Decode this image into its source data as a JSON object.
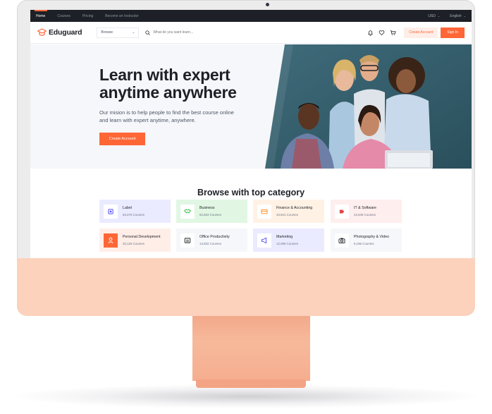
{
  "topbar": {
    "nav": [
      {
        "label": "Home",
        "active": true
      },
      {
        "label": "Courses",
        "active": false
      },
      {
        "label": "Pricing",
        "active": false
      },
      {
        "label": "Become an Instructor",
        "active": false
      }
    ],
    "currency": "USD",
    "language": "English"
  },
  "header": {
    "brand": "Eduguard",
    "browse_label": "Browse",
    "search_placeholder": "What do you want learn...",
    "icons": [
      "bell-icon",
      "heart-icon",
      "cart-icon"
    ],
    "create_account_label": "Create Account",
    "signin_label": "Sign In"
  },
  "hero": {
    "title_line1": "Learn with expert",
    "title_line2": "anytime anywhere",
    "description": "Our mision is to help people to find the best course online and learn with expert anytime, anywhere.",
    "cta_label": "Create Account"
  },
  "categories": {
    "title": "Browse with top category",
    "items": [
      {
        "name": "Label",
        "count": "63,476 Courses",
        "icon": "cpu-icon",
        "bg": "#ebebff",
        "icon_color": "#564ffd"
      },
      {
        "name": "Business",
        "count": "52,822 Courses",
        "icon": "handshake-icon",
        "bg": "#e1f7e3",
        "icon_color": "#23bd33"
      },
      {
        "name": "Finance & Accounting",
        "count": "33,841 Courses",
        "icon": "credit-card-icon",
        "bg": "#fff2e5",
        "icon_color": "#fd8e1f"
      },
      {
        "name": "IT & Software",
        "count": "22,649 Courses",
        "icon": "bug-icon",
        "bg": "#ffeeee",
        "icon_color": "#e34444"
      },
      {
        "name": "Personal Development",
        "count": "20,126 Courses",
        "icon": "user-icon",
        "bg": "#ffeee8",
        "icon_color": "#ffffff",
        "icon_bg": "#ff6636"
      },
      {
        "name": "Office Productivity",
        "count": "13,932 Courses",
        "icon": "receipt-icon",
        "bg": "#f5f7fa",
        "icon_color": "#1d2026"
      },
      {
        "name": "Marketing",
        "count": "12,068 Courses",
        "icon": "megaphone-icon",
        "bg": "#ebebff",
        "icon_color": "#564ffd"
      },
      {
        "name": "Photography & Video",
        "count": "6,196 Courses",
        "icon": "camera-icon",
        "bg": "#f5f7fa",
        "icon_color": "#1d2026"
      }
    ]
  },
  "colors": {
    "accent": "#ff6636",
    "dark": "#1d2026",
    "monitor_chin": "#fcd2bd",
    "stand": "#f5ae8f"
  }
}
